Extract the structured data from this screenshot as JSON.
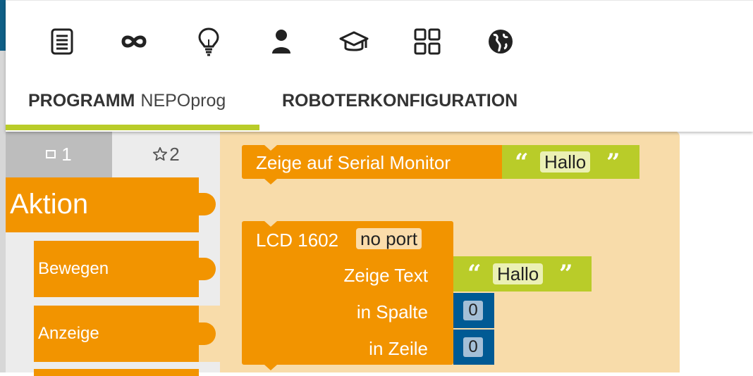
{
  "toolbar": {
    "icons": [
      {
        "name": "program-list-icon",
        "glyph": "☰"
      },
      {
        "name": "infinity-icon",
        "glyph": "∞"
      },
      {
        "name": "lightbulb-icon",
        "glyph": ""
      },
      {
        "name": "user-icon",
        "glyph": ""
      },
      {
        "name": "graduation-cap-icon",
        "glyph": ""
      },
      {
        "name": "grid-icon",
        "glyph": ""
      },
      {
        "name": "globe-icon",
        "glyph": ""
      }
    ]
  },
  "tabs": {
    "program_label": "PROGRAMM",
    "program_name": "NEPOprog",
    "robot_config_label": "ROBOTERKONFIGURATION"
  },
  "toolbox": {
    "tab1_label": "1",
    "tab2_label": "2",
    "category_main": "Aktion",
    "sub_categories": [
      "Bewegen",
      "Anzeige"
    ]
  },
  "workspace": {
    "serial_block": {
      "label": "Zeige auf Serial Monitor",
      "text": "Hallo"
    },
    "lcd_block": {
      "title": "LCD 1602",
      "port": "no port",
      "show_text_label": "Zeige Text",
      "text": "Hallo",
      "column_label": "in Spalte",
      "column_value": "0",
      "row_label": "in Zeile",
      "row_value": "0"
    }
  },
  "colors": {
    "block_orange": "#f29400",
    "text_green": "#b9cc29",
    "number_blue": "#005a94",
    "workspace_bg": "#f8dcaa",
    "accent_underline": "#b9cc29"
  }
}
